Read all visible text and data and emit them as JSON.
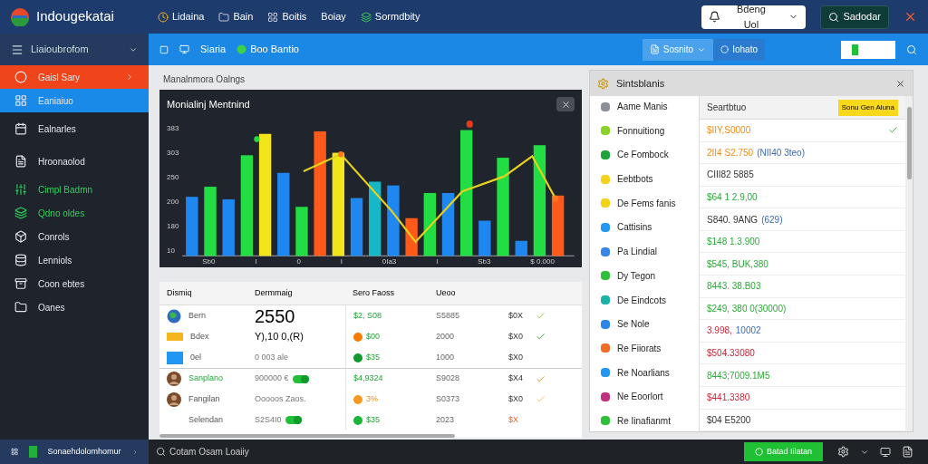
{
  "app": {
    "title": "Indougekatai",
    "nav": [
      "Lidaina",
      "Bain",
      "Boitis",
      "Boiay",
      "Sormdbity"
    ],
    "account": "Bdeng Uol",
    "search_button": "Sadodar"
  },
  "toolbar": {
    "menu": "Liaioubrofom",
    "items": [
      "Siaria",
      "Boo Bantio"
    ],
    "dropdown": "Sosnito",
    "button": "Iohato"
  },
  "sidebar": {
    "items": [
      {
        "label": "Gaisl Sary",
        "selected": true,
        "kind": "plain"
      },
      {
        "label": "Eaniaiuo",
        "selected": false,
        "kind": "active"
      },
      {
        "label": "Ealnarles",
        "selected": false,
        "kind": "plain"
      },
      {
        "label": "Hroonaolod",
        "selected": false,
        "kind": "plain"
      },
      {
        "label": "Cimpl Badmn",
        "selected": false,
        "kind": "green"
      },
      {
        "label": "Qdno oldes",
        "selected": false,
        "kind": "green"
      },
      {
        "label": "Conrols",
        "selected": false,
        "kind": "plain"
      },
      {
        "label": "Lenniols",
        "selected": false,
        "kind": "plain"
      },
      {
        "label": "Coon ebtes",
        "selected": false,
        "kind": "plain"
      },
      {
        "label": "Oanes",
        "selected": false,
        "kind": "plain"
      }
    ]
  },
  "main": {
    "title": "Manalnmora Oalngs",
    "chart": {
      "title": "Monialinj Mentnind",
      "y_labels": [
        "383",
        "303",
        "250",
        "200",
        "180",
        "10"
      ],
      "x_labels": [
        "Sb0",
        "I",
        "0",
        "I",
        "0Ia3",
        "I",
        "Sb3",
        "$ 0.000"
      ]
    },
    "table": {
      "columns": [
        "Dismiq",
        "Dermmaig",
        "Sero Faoss",
        "Ueoo"
      ],
      "rows": [
        {
          "kind": "globe",
          "name": "Bern",
          "detail": "2550",
          "large": true,
          "dark": true,
          "price": {
            "text": "$2, S08",
            "kind": "green"
          },
          "amount": "S5885",
          "fee": {
            "text": "$0X",
            "kind": "dark"
          },
          "check": {
            "kind": "lime"
          },
          "highlight": false
        },
        {
          "kind": "bar",
          "name": "Bdex",
          "detail": "Y),10 0,(R)",
          "large": false,
          "dark": true,
          "price": {
            "text": "$00",
            "kind": "green"
          },
          "dot": {
            "color": "#f57c00"
          },
          "amount": "2000",
          "fee": {
            "text": "$X0",
            "kind": "dark"
          },
          "check": {
            "kind": "green"
          },
          "highlight": false
        },
        {
          "kind": "tile",
          "name": "0el",
          "detail": "0 003 ale",
          "large": false,
          "dark": false,
          "price": {
            "text": "$35",
            "kind": "green"
          },
          "dot": {
            "color": "#139a2f"
          },
          "amount": "1000",
          "fee": {
            "text": "$X0",
            "kind": "dark"
          },
          "highlight": false
        },
        {
          "kind": "avatar",
          "name": "Sanplano",
          "detail": "900000 €",
          "large": false,
          "dark": false,
          "price": {
            "text": "$4,9324",
            "kind": "green"
          },
          "amount": "S9028",
          "fee": {
            "text": "$X4",
            "kind": "dark"
          },
          "check": {
            "kind": "orange"
          },
          "toggle": true,
          "highlight": true
        },
        {
          "kind": "avatar",
          "name": "Fangilan",
          "detail": "Ooooos Zaos.",
          "large": false,
          "dark": false,
          "price": {
            "text": "3%",
            "kind": "orange"
          },
          "dot": {
            "color": "#f59a1f"
          },
          "amount": "S0373",
          "fee": {
            "text": "$X0",
            "kind": "dark"
          },
          "check": {
            "kind": "pale"
          },
          "highlight": false
        },
        {
          "kind": "none",
          "name": "Selendan",
          "detail": "S2S4I0",
          "large": false,
          "dark": false,
          "price": {
            "text": "$35",
            "kind": "green"
          },
          "dot": {
            "color": "#1fb53a"
          },
          "amount": "2023",
          "fee": {
            "text": "$X",
            "kind": "orange"
          },
          "toggle": true,
          "highlight": false
        }
      ]
    }
  },
  "side_panel": {
    "title": "Sintsblanis",
    "list": [
      {
        "label": "Aame Manis",
        "color": "#8a8f99"
      },
      {
        "label": "Fonnuitiong",
        "color": "#8bd12a"
      },
      {
        "label": "Ce Fombock",
        "color": "#1ea53a"
      },
      {
        "label": "Eebtbots",
        "color": "#f2d21b"
      },
      {
        "label": "De Fems fanis",
        "color": "#f2d21b"
      },
      {
        "label": "Cattisins",
        "color": "#2196f3"
      },
      {
        "label": "Pa Lindial",
        "color": "#3a86e8"
      },
      {
        "label": "Dy Tegon",
        "color": "#2fbf3a"
      },
      {
        "label": "De Eindcots",
        "color": "#1ab3a6"
      },
      {
        "label": "Se Nole",
        "color": "#2b86e8"
      },
      {
        "label": "Re Fiiorats",
        "color": "#f26b22"
      },
      {
        "label": "Re Noarlians",
        "color": "#2196f3"
      },
      {
        "label": "Ne Eoorlort",
        "color": "#c2307f"
      },
      {
        "label": "Re Iinafianmt",
        "color": "#2fbf3a"
      }
    ],
    "column": "Seartbtuo",
    "action": "Sonu Gen Aluna",
    "values": [
      {
        "text": "$IIY,S0000",
        "kind": "orange",
        "checked": true
      },
      {
        "text": "2II4 S2.750",
        "note": "(NII40 3teo)",
        "kind": "orange",
        "checked": false
      },
      {
        "text": "CIII82 5885",
        "kind": "dark",
        "checked": false
      },
      {
        "text": "$64 1 2.9,00",
        "kind": "green",
        "checked": false
      },
      {
        "text": "S840. 9ANG",
        "note": "(629)",
        "kind": "dark",
        "checked": false
      },
      {
        "text": "$148 1.3.900",
        "kind": "green",
        "checked": false
      },
      {
        "text": "$545, BUK,380",
        "kind": "green",
        "checked": false
      },
      {
        "text": "8443. 38.B03",
        "kind": "green",
        "checked": false
      },
      {
        "text": "$249, 380 0(30000)",
        "kind": "green",
        "checked": false
      },
      {
        "text": "3.998,",
        "note": "10002",
        "kind": "red",
        "checked": false
      },
      {
        "text": "$504.33080",
        "kind": "red",
        "checked": false
      },
      {
        "text": "8443;7009.1M5",
        "kind": "green",
        "checked": false
      },
      {
        "text": "$441.3380",
        "kind": "red",
        "checked": false
      },
      {
        "text": "$04 E5200",
        "kind": "dark",
        "checked": false
      }
    ]
  },
  "taskbar": {
    "app": "Sonaehdolomhomur",
    "search": "Cotam Osam Loaiiy",
    "button": "Batad Iilatan"
  }
}
